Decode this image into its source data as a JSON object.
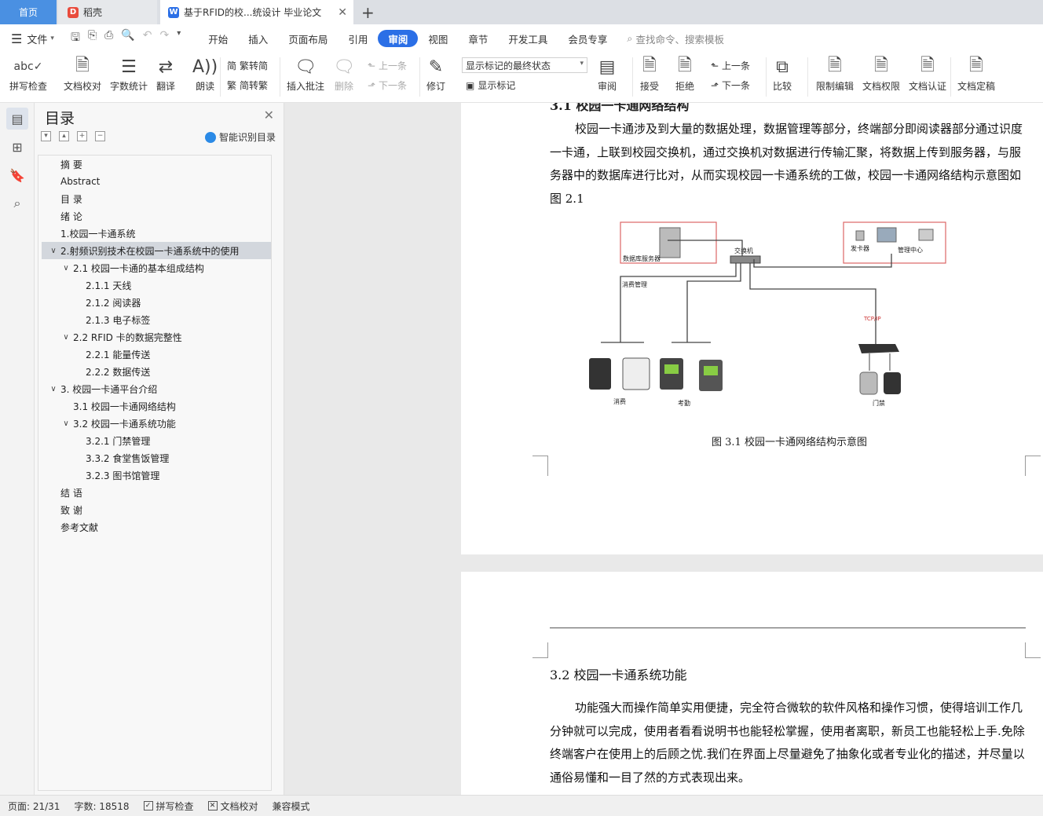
{
  "tabs": {
    "home": "首页",
    "daoke": "稻壳",
    "doc": "基于RFID的校...统设计 毕业论文"
  },
  "menubar": {
    "file": "文件",
    "items": [
      "开始",
      "插入",
      "页面布局",
      "引用",
      "审阅",
      "视图",
      "章节",
      "开发工具",
      "会员专享"
    ],
    "active": "审阅",
    "search": "查找命令、搜索模板"
  },
  "ribbon": {
    "spell": "拼写检查",
    "proof": "文档校对",
    "wordcount": "字数统计",
    "translate": "翻译",
    "read": "朗读",
    "trad": "繁转简",
    "simp": "简转繁",
    "insert_comment": "插入批注",
    "delete": "删除",
    "prev": "上一条",
    "next": "下一条",
    "revise": "修订",
    "markup_state": "显示标记的最终状态",
    "show_markup": "显示标记",
    "review": "审阅",
    "accept": "接受",
    "reject": "拒绝",
    "prev2": "上一条",
    "next2": "下一条",
    "compare": "比较",
    "restrict": "限制编辑",
    "rights": "文档权限",
    "cert": "文档认证",
    "finalize": "文档定稿"
  },
  "toc": {
    "title": "目录",
    "smart": "智能识别目录",
    "items": [
      {
        "label": "摘 要",
        "level": 1
      },
      {
        "label": "Abstract",
        "level": 1
      },
      {
        "label": "目 录",
        "level": 1
      },
      {
        "label": "绪 论",
        "level": 1
      },
      {
        "label": "1.校园一卡通系统",
        "level": 1
      },
      {
        "label": "2.射频识别技术在校园一卡通系统中的使用",
        "level": 0,
        "caret": true,
        "selected": true
      },
      {
        "label": "2.1 校园一卡通的基本组成结构",
        "level": 1,
        "caret": true
      },
      {
        "label": "2.1.1 天线",
        "level": 2
      },
      {
        "label": "2.1.2  阅读器",
        "level": 2
      },
      {
        "label": "2.1.3  电子标签",
        "level": 2
      },
      {
        "label": "2.2 RFID 卡的数据完整性",
        "level": 1,
        "caret": true
      },
      {
        "label": "2.2.1  能量传送",
        "level": 2
      },
      {
        "label": "2.2.2  数据传送",
        "level": 2
      },
      {
        "label": "3.  校园一卡通平台介绍",
        "level": 0,
        "caret": true
      },
      {
        "label": "3.1 校园一卡通网络结构",
        "level": 1
      },
      {
        "label": "3.2 校园一卡通系统功能",
        "level": 1,
        "caret": true
      },
      {
        "label": "3.2.1 门禁管理",
        "level": 2
      },
      {
        "label": "3.3.2 食堂售饭管理",
        "level": 2
      },
      {
        "label": "3.2.3 图书馆管理",
        "level": 2
      },
      {
        "label": "结  语",
        "level": 1
      },
      {
        "label": "致    谢",
        "level": 1
      },
      {
        "label": "参考文献",
        "level": 1
      }
    ]
  },
  "document": {
    "heading_cut": "3.1 校园一卡通网络结构",
    "para1": "校园一卡通涉及到大量的数据处理，数据管理等部分，终端部分即阅读器部分通过识度一卡通，上联到校园交换机，通过交换机对数据进行传输汇聚，将数据上传到服务器，与服务器中的数据库进行比对，从而实现校园一卡通系统的工做，校园一卡通网络结构示意图如图 2.1",
    "figure": {
      "db_server": "数据库服务器",
      "switch": "交换机",
      "card_issuer": "发卡器",
      "mgmt_center": "管理中心",
      "consumption_mgmt": "消费管理",
      "tcpip": "TCP/IP",
      "consume": "消费",
      "attendance": "考勤",
      "access": "门禁"
    },
    "caption": "图 3.1    校园一卡通网络结构示意图",
    "heading2": "3.2 校园一卡通系统功能",
    "para2": "功能强大而操作简单实用便捷，完全符合微软的软件风格和操作习惯，使得培训工作几分钟就可以完成，使用者看看说明书也能轻松掌握，使用者离职，新员工也能轻松上手.免除终端客户在使用上的后顾之忧.我们在界面上尽量避免了抽象化或者专业化的描述，并尽量以通俗易懂和一目了然的方式表现出来。"
  },
  "status": {
    "page": "页面: 21/31",
    "words": "字数: 18518",
    "spell": "拼写检查",
    "proof": "文档校对",
    "compat": "兼容模式"
  }
}
